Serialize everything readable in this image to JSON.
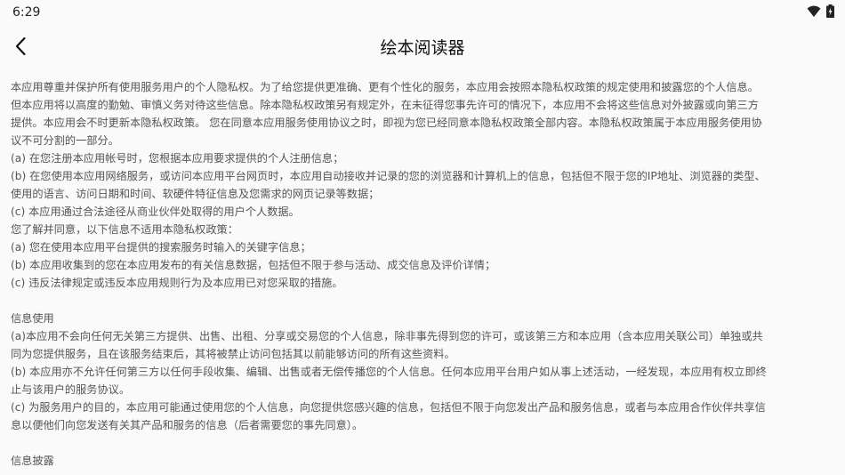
{
  "status_bar": {
    "time": "6:29",
    "icons": [
      "wifi-icon",
      "battery-icon"
    ]
  },
  "app_bar": {
    "back_icon": "back-arrow-icon",
    "title": "绘本阅读器"
  },
  "content": {
    "section1": [
      "本应用尊重并保护所有使用服务用户的个人隐私权。为了给您提供更准确、更有个性化的服务，本应用会按照本隐私权政策的规定使用和披露您的个人信息。",
      "但本应用将以高度的勤勉、审慎义务对待这些信息。除本隐私权政策另有规定外，在未征得您事先许可的情况下，本应用不会将这些信息对外披露或向第三方",
      "提供。本应用会不时更新本隐私权政策。 您在同意本应用服务使用协议之时，即视为您已经同意本隐私权政策全部内容。本隐私权政策属于本应用服务使用协",
      "议不可分割的一部分。",
      "(a) 在您注册本应用帐号时，您根据本应用要求提供的个人注册信息；",
      "(b) 在您使用本应用网络服务，或访问本应用平台网页时，本应用自动接收并记录的您的浏览器和计算机上的信息，包括但不限于您的IP地址、浏览器的类型、",
      "使用的语言、访问日期和时间、软硬件特征信息及您需求的网页记录等数据；",
      "(c) 本应用通过合法途径从商业伙伴处取得的用户个人数据。",
      "您了解并同意，以下信息不适用本隐私权政策：",
      "(a) 您在使用本应用平台提供的搜索服务时输入的关键字信息；",
      "(b) 本应用收集到的您在本应用发布的有关信息数据，包括但不限于参与活动、成交信息及评价详情；",
      "(c) 违反法律规定或违反本应用规则行为及本应用已对您采取的措施。"
    ],
    "section2_heading": "信息使用",
    "section2": [
      "(a)本应用不会向任何无关第三方提供、出售、出租、分享或交易您的个人信息，除非事先得到您的许可，或该第三方和本应用（含本应用关联公司）单独或共",
      "同为您提供服务，且在该服务结束后，其将被禁止访问包括其以前能够访问的所有这些资料。",
      "(b) 本应用亦不允许任何第三方以任何手段收集、编辑、出售或者无偿传播您的个人信息。任何本应用平台用户如从事上述活动，一经发现，本应用有权立即终",
      "止与该用户的服务协议。",
      "(c) 为服务用户的目的，本应用可能通过使用您的个人信息，向您提供您感兴趣的信息，包括但不限于向您发出产品和服务信息，或者与本应用合作伙伴共享信",
      "息以便他们向您发送有关其产品和服务的信息（后者需要您的事先同意）。"
    ],
    "section3_heading": "信息披露"
  }
}
